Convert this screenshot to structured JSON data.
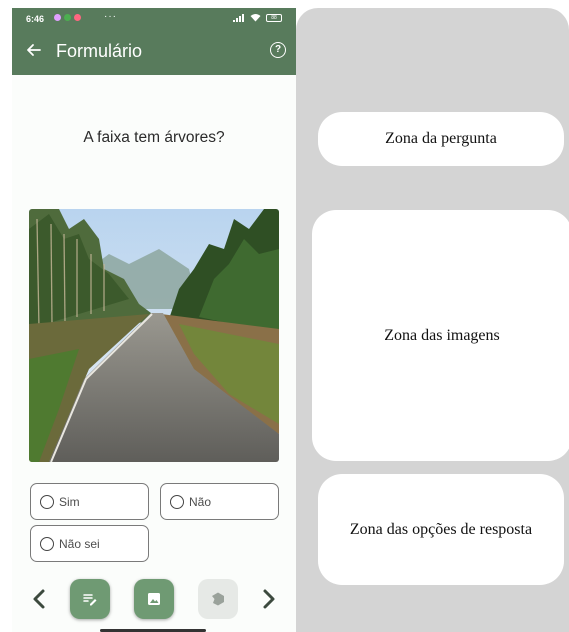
{
  "status_bar": {
    "time": "6:46",
    "more": "···",
    "battery": "88"
  },
  "app_bar": {
    "title": "Formulário",
    "back_icon": "arrow-left-icon",
    "help_icon": "help-circle-icon",
    "help_glyph": "?"
  },
  "question": {
    "text": "A faixa tem árvores?"
  },
  "image": {
    "description_icon": "road-with-trees-photo"
  },
  "options": [
    {
      "label": "Sim",
      "selected": false
    },
    {
      "label": "Não",
      "selected": false
    },
    {
      "label": "Não sei",
      "selected": false
    }
  ],
  "bottom_nav": {
    "prev_icon": "chevron-left-icon",
    "next_icon": "chevron-right-icon",
    "buttons": [
      {
        "icon": "form-edit-icon",
        "active": true
      },
      {
        "icon": "image-icon",
        "active": true
      },
      {
        "icon": "polygon-icon",
        "active": false
      }
    ]
  },
  "annotations": {
    "question_zone": "Zona da pergunta",
    "images_zone": "Zona das imagens",
    "options_zone": "Zona das opções de resposta"
  },
  "colors": {
    "primary": "#587b5c",
    "fab": "#6f9a73",
    "fab_disabled": "#e6e9e6",
    "panel_bg": "#d4d4d4"
  }
}
